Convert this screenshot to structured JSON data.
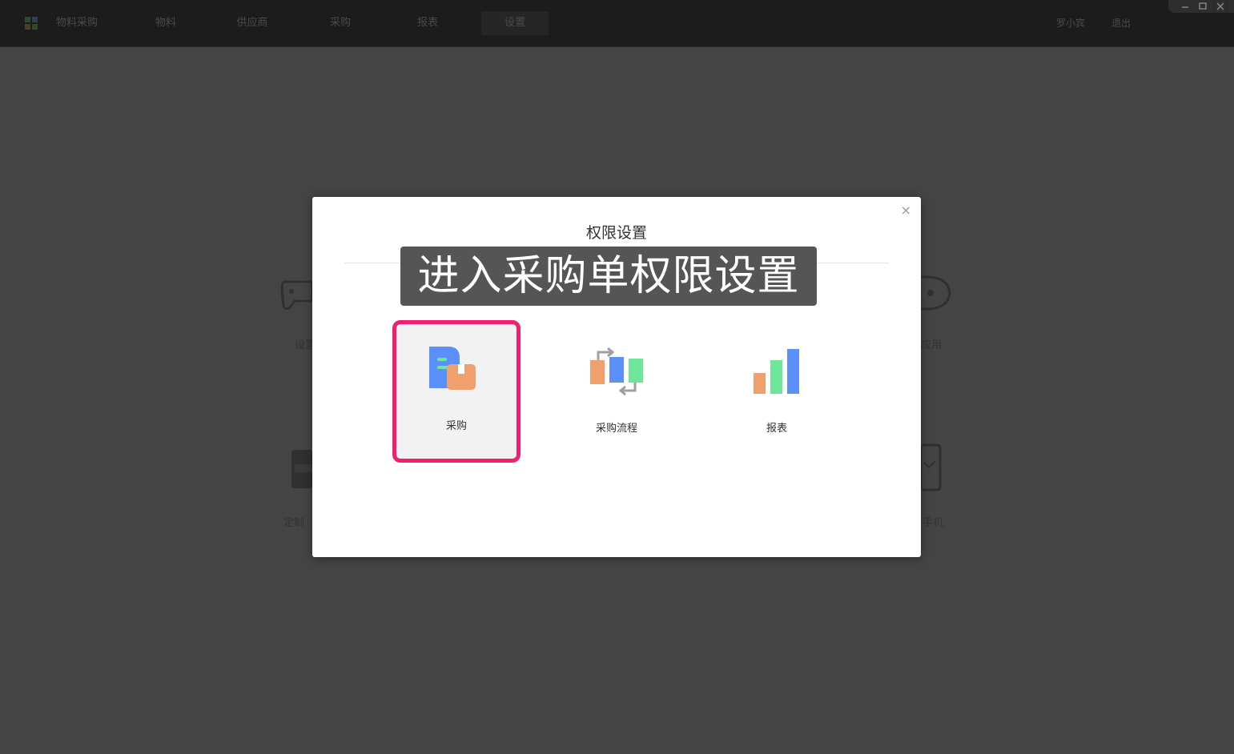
{
  "app": {
    "title": "物料采购"
  },
  "nav": {
    "items": [
      {
        "label": "物料"
      },
      {
        "label": "供应商"
      },
      {
        "label": "采购"
      },
      {
        "label": "报表"
      },
      {
        "label": "设置"
      }
    ],
    "active": "设置"
  },
  "user": {
    "name": "罗小宾",
    "logout": "退出"
  },
  "background": {
    "tiles": [
      {
        "label": "设置"
      },
      {
        "label": "应用"
      },
      {
        "label": "定制"
      },
      {
        "label": "手机"
      }
    ]
  },
  "modal": {
    "title": "权限设置",
    "close": "×",
    "caption": "进入采购单权限设置",
    "tiles": [
      {
        "label": "采购",
        "selected": true
      },
      {
        "label": "采购流程",
        "selected": false
      },
      {
        "label": "报表",
        "selected": false
      }
    ]
  },
  "colors": {
    "highlight": "#f21f71",
    "blue": "#5b8ff9",
    "orange": "#f0a06c",
    "green": "#6ee69a"
  }
}
